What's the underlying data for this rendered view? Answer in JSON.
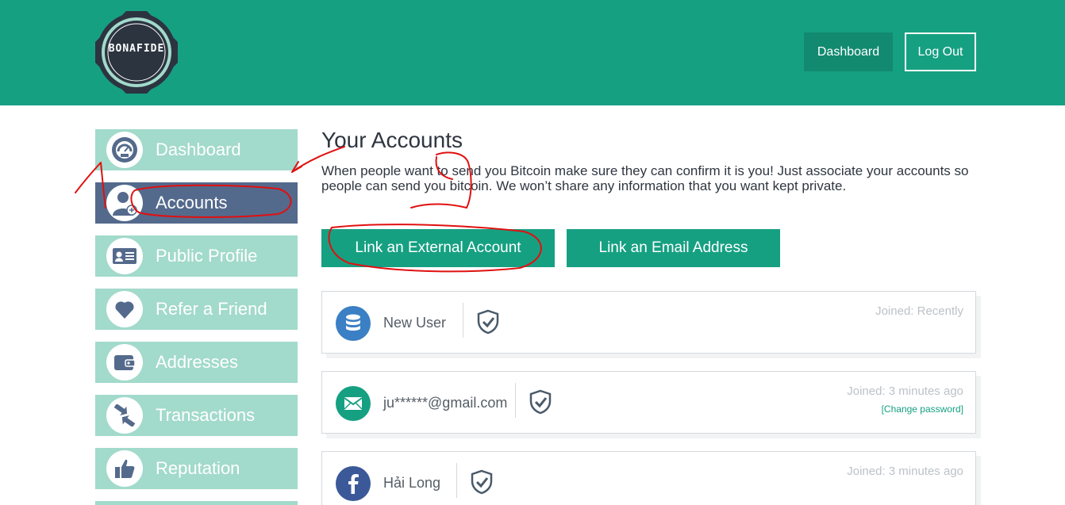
{
  "header": {
    "logo_text": "BONAFIDE",
    "nav": {
      "dashboard_label": "Dashboard",
      "logout_label": "Log Out"
    }
  },
  "sidebar": {
    "items": [
      {
        "label": "Dashboard",
        "icon": "speedometer-icon",
        "active": false
      },
      {
        "label": "Accounts",
        "icon": "user-add-icon",
        "active": true
      },
      {
        "label": "Public Profile",
        "icon": "id-card-icon",
        "active": false
      },
      {
        "label": "Refer a Friend",
        "icon": "heart-icon",
        "active": false
      },
      {
        "label": "Addresses",
        "icon": "wallet-icon",
        "active": false
      },
      {
        "label": "Transactions",
        "icon": "transfer-arrows-icon",
        "active": false
      },
      {
        "label": "Reputation",
        "icon": "thumbs-up-icon",
        "active": false
      }
    ]
  },
  "main": {
    "title": "Your Accounts",
    "description": "When people want to send you Bitcoin make sure they can confirm it is you! Just associate your accounts so people can send you bitcoin. We won’t share any information that you want kept private.",
    "buttons": {
      "external_label": "Link an External Account",
      "email_label": "Link an Email Address"
    },
    "accounts": [
      {
        "name": "New User",
        "joined": "Joined: Recently",
        "icon": "database-icon",
        "icon_color": "#3b7fc4"
      },
      {
        "name": "ju******@gmail.com",
        "joined": "Joined: 3 minutes ago",
        "link": "[Change password]",
        "icon": "envelope-icon",
        "icon_color": "#16a082"
      },
      {
        "name": "Hải Long",
        "joined": "Joined: 3 minutes ago",
        "icon": "facebook-icon",
        "icon_color": "#3b5998"
      }
    ]
  },
  "colors": {
    "brand_green": "#16a082",
    "sidebar_inactive": "#a2dacb",
    "sidebar_active": "#546a8c",
    "annotation_red": "#e01010"
  }
}
